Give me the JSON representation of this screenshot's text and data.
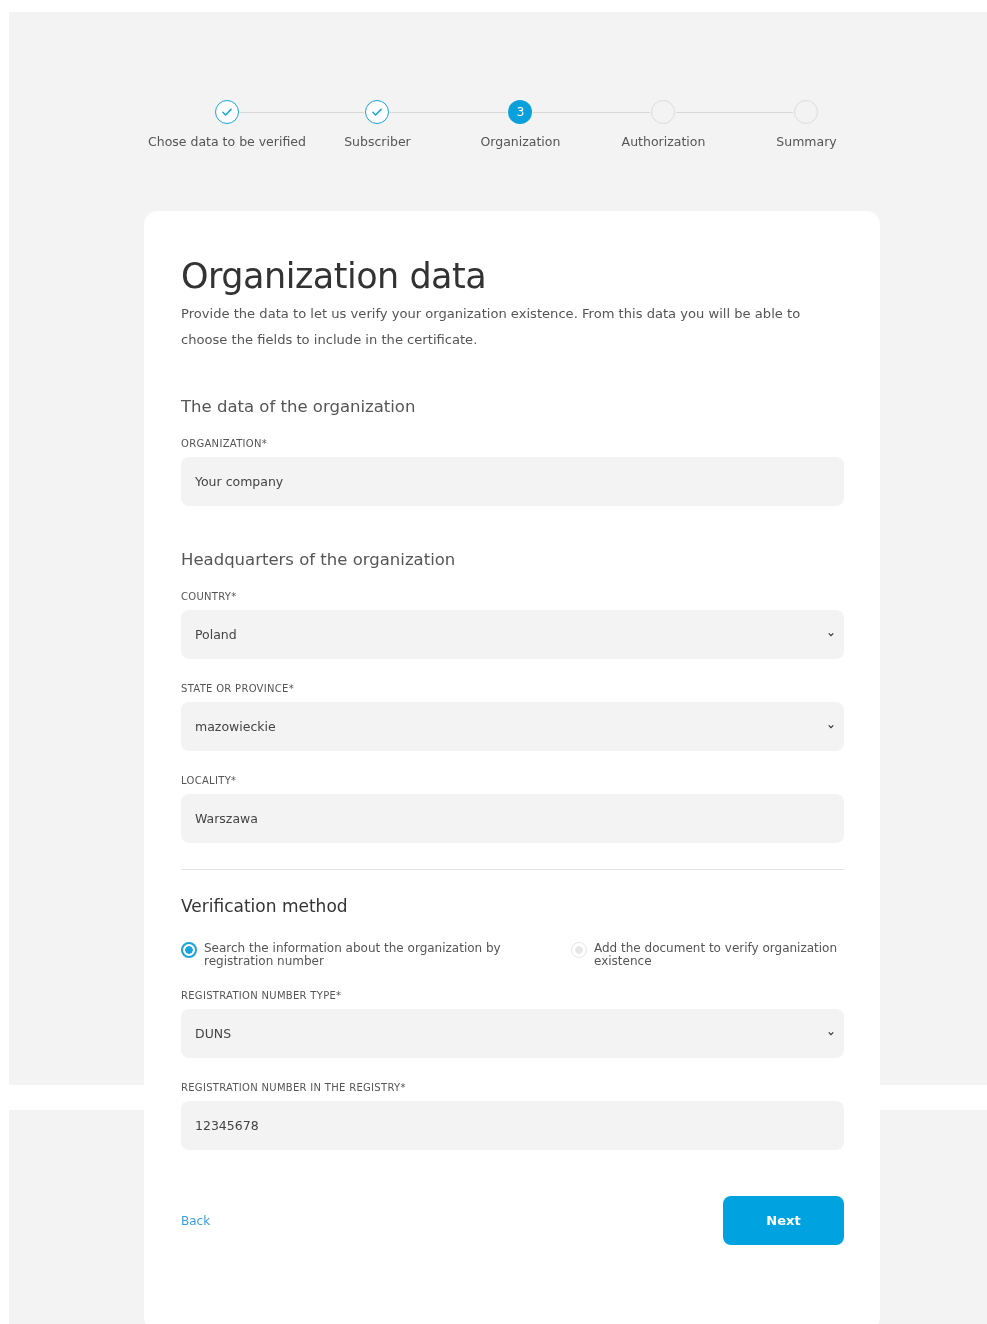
{
  "steps": [
    {
      "label": "Chose data to be verified",
      "kind": "done"
    },
    {
      "label": "Subscriber",
      "kind": "done"
    },
    {
      "label": "Organization",
      "kind": "current",
      "number": "3"
    },
    {
      "label": "Authorization",
      "kind": "todo"
    },
    {
      "label": "Summary",
      "kind": "todo"
    }
  ],
  "card": {
    "title": "Organization data",
    "description": "Provide the data to let us verify your organization existence. From this data you will be able to choose the fields to include in the certificate.",
    "blocks": [
      {
        "kind": "subheading",
        "text": "The data of the organization"
      },
      {
        "kind": "text_field",
        "label": "ORGANIZATION*",
        "placeholder": "Your company"
      },
      {
        "kind": "subheading",
        "text": "Headquarters of the organization"
      },
      {
        "kind": "select_field",
        "label": "COUNTRY*",
        "value": "Poland"
      },
      {
        "kind": "select_field",
        "label": "STATE OR PROVINCE*",
        "value": "mazowieckie"
      },
      {
        "kind": "text_field",
        "label": "LOCALITY*",
        "value": "Warszawa"
      },
      {
        "kind": "divider"
      },
      {
        "kind": "section_title",
        "text": "Verification method"
      },
      {
        "kind": "radios",
        "options": [
          {
            "label": "Search the information about the organization by registration number",
            "selected": true
          },
          {
            "label": "Add the document to verify organization existence",
            "selected": false
          }
        ]
      },
      {
        "kind": "select_field",
        "label": "REGISTRATION NUMBER TYPE*",
        "value": "DUNS"
      },
      {
        "kind": "text_field",
        "label": "REGISTRATION NUMBER IN THE REGISTRY*",
        "value": "12345678"
      }
    ],
    "back": "Back",
    "next": "Next"
  }
}
